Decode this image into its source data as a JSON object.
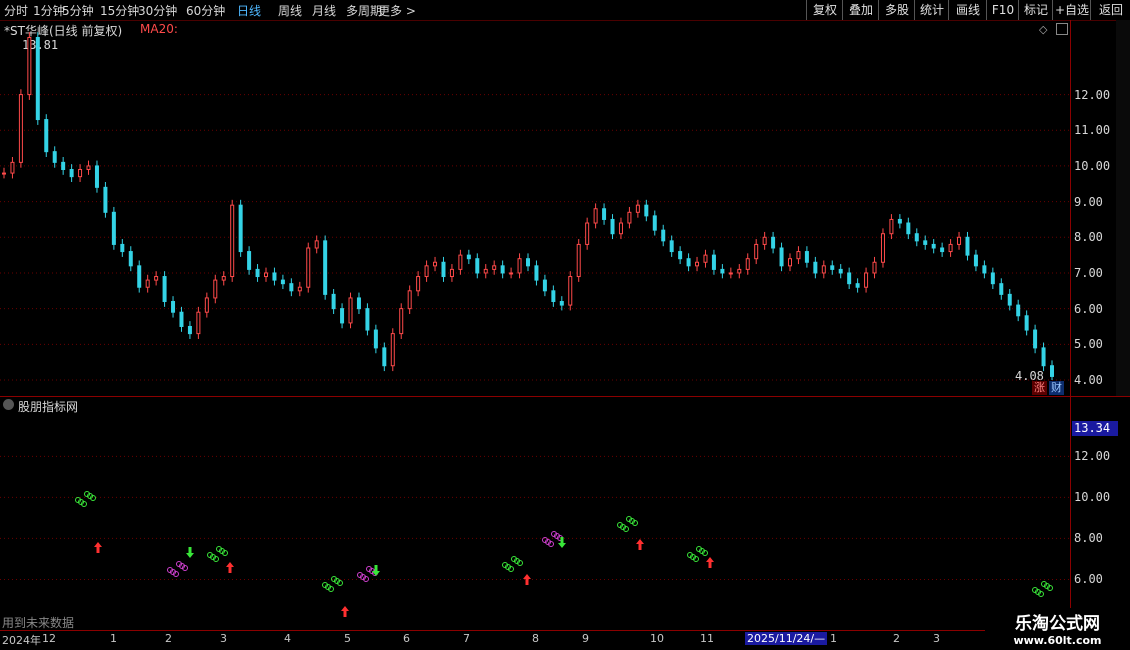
{
  "toolbar": {
    "timeframes": [
      "分时",
      "1分钟",
      "5分钟",
      "15分钟",
      "30分钟",
      "60分钟",
      "日线",
      "周线",
      "月线",
      "多周期",
      "更多 >"
    ],
    "active_timeframe": "日线",
    "buttons": [
      "复权",
      "叠加",
      "多股",
      "统计",
      "画线",
      "F10",
      "标记",
      "+自选",
      "返回"
    ]
  },
  "main_chart": {
    "stock_title": "*ST华峰(日线 前复权)",
    "ma_label": "MA20:",
    "high_label": "13.81",
    "low_label": "4.08",
    "y_ticks": [
      "12.00",
      "11.00",
      "10.00",
      "9.00",
      "8.00",
      "7.00",
      "6.00",
      "5.00",
      "4.00"
    ],
    "badge_up": "涨",
    "badge_fin": "财"
  },
  "indicator": {
    "title": "股朋指标网",
    "current_value": "13.34",
    "y_ticks": [
      "12.00",
      "10.00",
      "8.00",
      "6.00"
    ],
    "footnote": "用到未来数据"
  },
  "x_axis": {
    "labels": [
      "2024年",
      "12",
      "1",
      "2",
      "3",
      "4",
      "5",
      "6",
      "7",
      "8",
      "9",
      "10",
      "11",
      "2025/11/24/—",
      "1",
      "2",
      "3"
    ]
  },
  "watermark": {
    "line1": "乐淘公式网",
    "line2": "www.60lt.com"
  },
  "colors": {
    "up": "#ff4a4a",
    "down": "#34d3e6",
    "grid": "#8b0000",
    "signal_green": "#39e639",
    "signal_magenta": "#d040d0"
  },
  "chart_data": {
    "type": "candlestick",
    "ylim": [
      4.0,
      13.81
    ],
    "ticks": [
      12,
      11,
      10,
      9,
      8,
      7,
      6,
      5,
      4
    ],
    "series": [
      {
        "values": [
          9.8,
          10.1,
          12.0,
          13.6,
          11.3,
          10.4,
          10.1,
          9.9,
          9.7,
          9.9,
          10.0,
          9.4,
          8.7,
          7.8,
          7.6,
          7.2,
          6.6,
          6.8,
          6.9,
          6.2,
          5.9,
          5.5,
          5.3,
          5.9,
          6.3,
          6.8,
          6.9,
          8.9,
          7.6,
          7.1,
          6.9,
          7.0,
          6.8,
          6.7,
          6.5,
          6.6,
          7.7,
          7.9,
          6.4,
          6.0,
          5.6,
          6.3,
          6.0,
          5.4,
          4.9,
          4.4,
          5.3,
          6.0,
          6.5,
          6.9,
          7.2,
          7.3,
          6.9,
          7.1,
          7.5,
          7.4,
          7.0,
          7.1,
          7.2,
          7.0,
          7.0,
          7.4,
          7.2,
          6.8,
          6.5,
          6.2,
          6.1,
          6.9,
          7.8,
          8.4,
          8.8,
          8.5,
          8.1,
          8.4,
          8.7,
          8.9,
          8.6,
          8.2,
          7.9,
          7.6,
          7.4,
          7.2,
          7.3,
          7.5,
          7.1,
          7.0,
          7.0,
          7.1,
          7.4,
          7.8,
          8.0,
          7.7,
          7.2,
          7.4,
          7.6,
          7.3,
          7.0,
          7.2,
          7.1,
          7.0,
          6.7,
          6.6,
          7.0,
          7.3,
          8.1,
          8.5,
          8.4,
          8.1,
          7.9,
          7.8,
          7.7,
          7.6,
          7.8,
          8.0,
          7.5,
          7.2,
          7.0,
          6.7,
          6.4,
          6.1,
          5.8,
          5.4,
          4.9,
          4.4,
          4.1
        ]
      }
    ]
  }
}
